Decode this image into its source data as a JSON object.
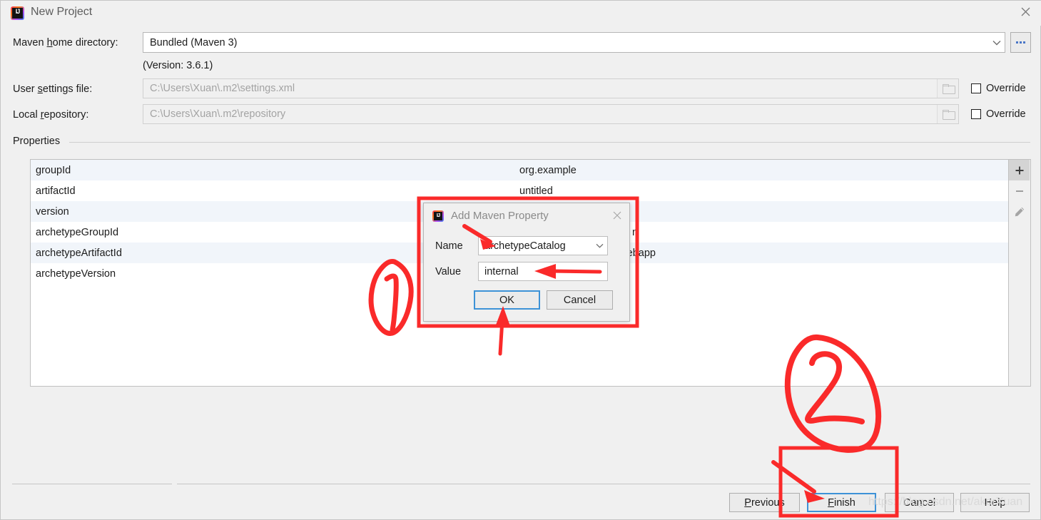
{
  "window": {
    "title": "New Project",
    "logo_icon": "intellij-idea-logo",
    "close_icon": "close-icon"
  },
  "form": {
    "maven_home": {
      "label_pre": "Maven ",
      "label_accel": "h",
      "label_post": "ome directory:",
      "label_full": "Maven home directory:",
      "value": "Bundled (Maven 3)",
      "dropdown_icon": "chevron-down-icon",
      "browse_label": "...",
      "version_note": "(Version: 3.6.1)"
    },
    "user_settings": {
      "label_pre": "User ",
      "label_accel": "s",
      "label_post": "ettings file:",
      "label_full": "User settings file:",
      "value": "C:\\Users\\Xuan\\.m2\\settings.xml",
      "folder_icon": "folder-icon",
      "override_label": "Override",
      "override_checked": false
    },
    "local_repository": {
      "label_pre": "Local ",
      "label_accel": "r",
      "label_post": "epository:",
      "label_full": "Local repository:",
      "value": "C:\\Users\\Xuan\\.m2\\repository",
      "folder_icon": "folder-icon",
      "override_label": "Override",
      "override_checked": false
    }
  },
  "properties": {
    "group_label": "Properties",
    "rows": [
      {
        "key": "groupId",
        "value": "org.example"
      },
      {
        "key": "artifactId",
        "value": "untitled"
      },
      {
        "key": "version",
        "value": ""
      },
      {
        "key": "archetypeGroupId",
        "value": "n"
      },
      {
        "key": "archetypeArtifactId",
        "value": "ype-webapp"
      },
      {
        "key": "archetypeVersion",
        "value": ""
      }
    ],
    "tools": {
      "add_icon": "plus-icon",
      "remove_icon": "minus-icon",
      "edit_icon": "pencil-icon"
    }
  },
  "dialog": {
    "title": "Add Maven Property",
    "logo_icon": "intellij-idea-logo",
    "close_icon": "close-icon",
    "name_label": "Name",
    "name_value": "archetypeCatalog",
    "name_dropdown_icon": "chevron-down-icon",
    "value_label": "Value",
    "value_value": "internal",
    "ok_label": "OK",
    "cancel_label": "Cancel"
  },
  "footer": {
    "previous": {
      "pre": "",
      "accel": "P",
      "post": "revious",
      "full": "Previous"
    },
    "finish": {
      "pre": "",
      "accel": "F",
      "post": "inish",
      "full": "Finish"
    },
    "cancel": {
      "pre": "",
      "accel": "",
      "post": "Cancel",
      "full": "Cancel"
    },
    "help": {
      "pre": "",
      "accel": "",
      "post": "Help",
      "full": "Help"
    }
  },
  "annotations": {
    "step_one": "1",
    "step_two": "2",
    "color": "#fa2a2a"
  },
  "watermark": "https://blog.csdn.net/akorXuan"
}
